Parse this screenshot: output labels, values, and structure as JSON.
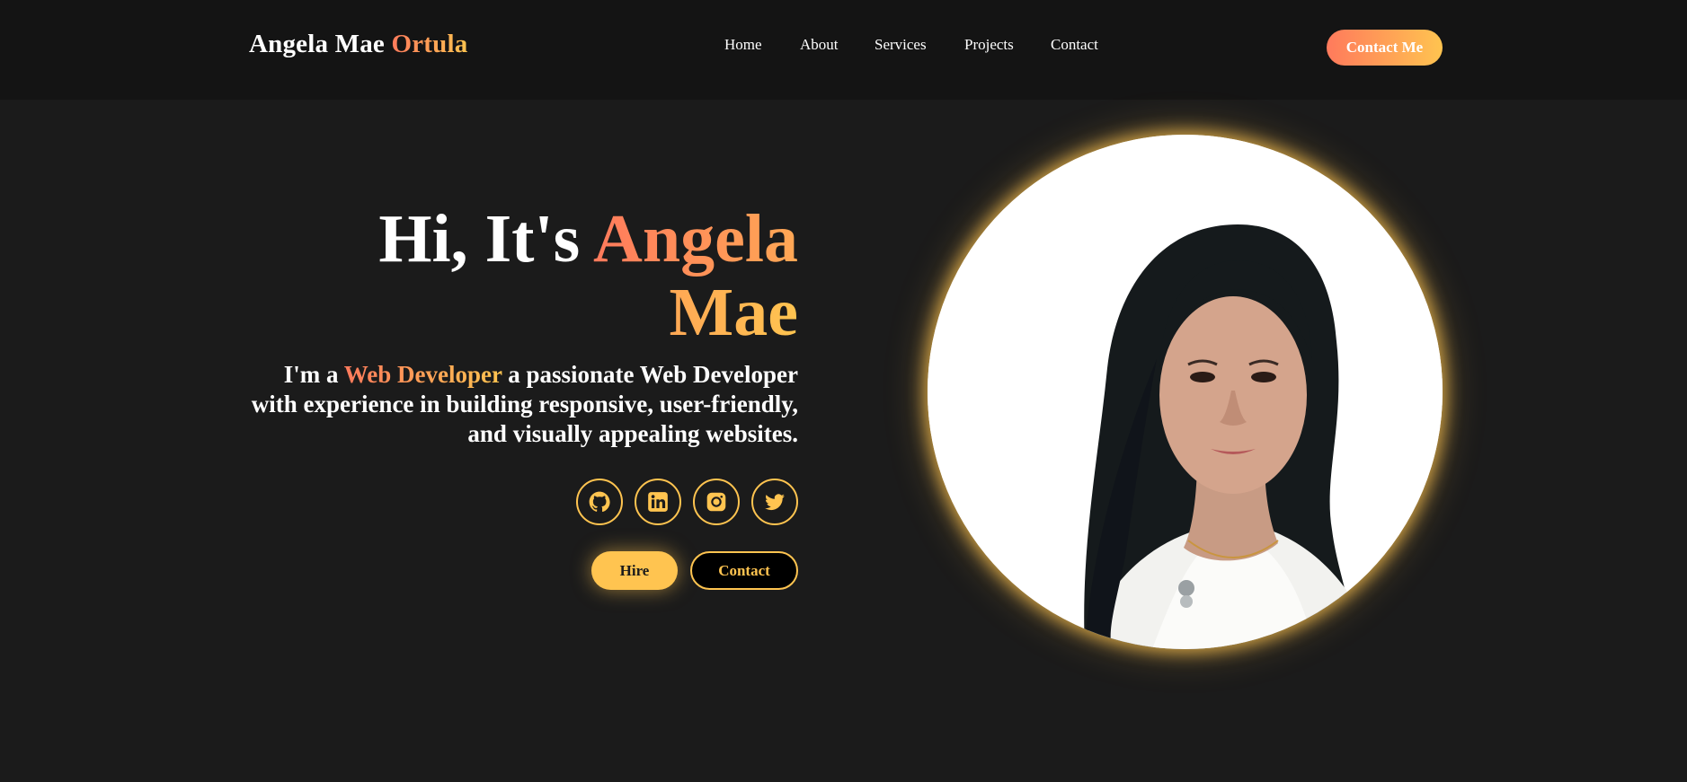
{
  "header": {
    "logo_first": "Angela Mae ",
    "logo_accent": "Ortula",
    "nav": [
      "Home",
      "About",
      "Services",
      "Projects",
      "Contact"
    ],
    "cta_label": "Contact Me"
  },
  "hero": {
    "title_prefix": "Hi, It's ",
    "title_name": "Angela Mae",
    "sub_prefix": "I'm a ",
    "sub_role": "Web Developer",
    "sub_rest": " a passionate Web Developer with experience in building responsive, user-friendly, and visually appealing websites.",
    "socials": [
      "github-icon",
      "linkedin-icon",
      "instagram-icon",
      "twitter-icon"
    ],
    "hire_label": "Hire",
    "contact_label": "Contact"
  },
  "colors": {
    "background": "#1b1b1b",
    "header_bg": "#141414",
    "accent_start": "#ff7a5c",
    "accent_end": "#ffc450"
  }
}
